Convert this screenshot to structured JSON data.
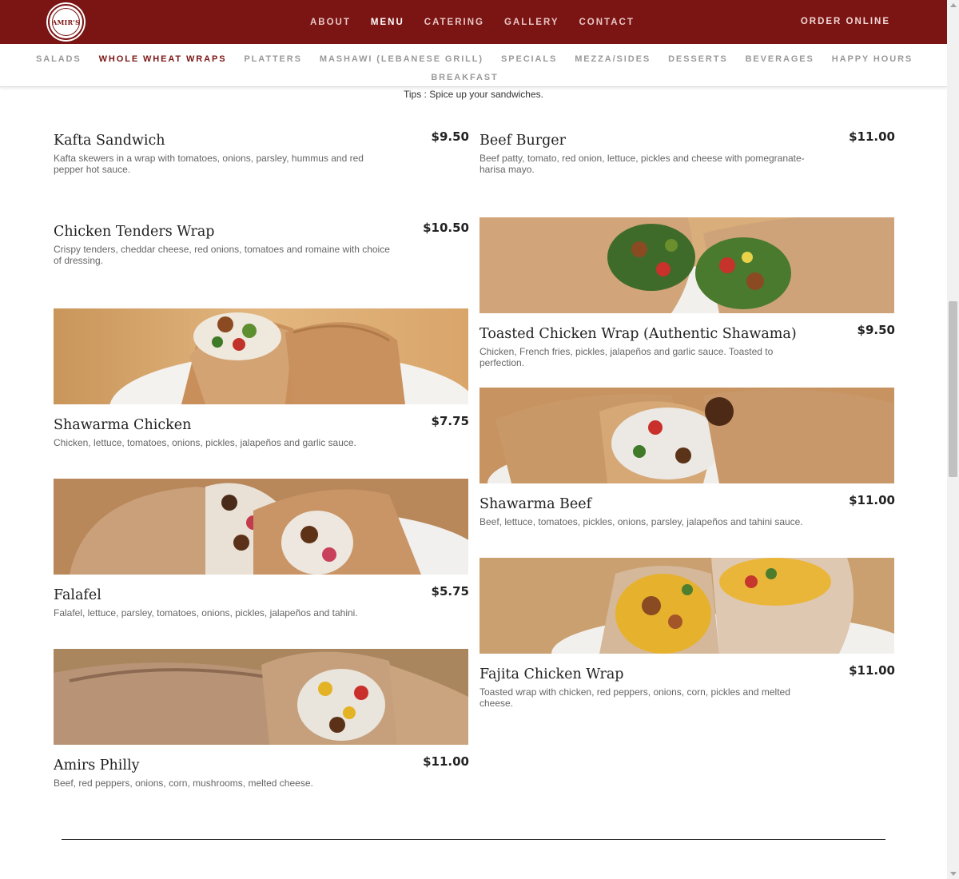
{
  "brand": {
    "logo_text": "AMIR'S",
    "color": "#7b1514"
  },
  "main_nav": {
    "items": [
      "ABOUT",
      "MENU",
      "CATERING",
      "GALLERY",
      "CONTACT"
    ],
    "active": "MENU",
    "order_online": "ORDER ONLINE"
  },
  "sub_nav": {
    "items": [
      "SALADS",
      "WHOLE WHEAT WRAPS",
      "PLATTERS",
      "MASHAWI (LEBANESE GRILL)",
      "SPECIALS",
      "MEZZA/SIDES",
      "DESSERTS",
      "BEVERAGES",
      "HAPPY HOURS"
    ],
    "second_row": "BREAKFAST",
    "active": "WHOLE WHEAT WRAPS"
  },
  "tips": "Tips : Spice up your sandwiches.",
  "menu": {
    "left": [
      {
        "name": "Kafta Sandwich",
        "price": "$9.50",
        "desc": "Kafta skewers in a wrap with tomatoes, onions, parsley, hummus and red pepper hot sauce.",
        "photo": ""
      },
      {
        "name": "Chicken Tenders Wrap",
        "price": "$10.50",
        "desc": "Crispy tenders, cheddar cheese, red onions, tomatoes and romaine with choice of dressing.",
        "photo": ""
      },
      {
        "name": "Shawarma Chicken",
        "price": "$7.75",
        "desc": "Chicken, lettuce, tomatoes, onions, pickles, jalapeños and garlic sauce.",
        "photo": "wrap-chicken"
      },
      {
        "name": "Falafel",
        "price": "$5.75",
        "desc": "Falafel, lettuce, parsley, tomatoes, onions, pickles, jalapeños and tahini.",
        "photo": "wrap-falafel"
      },
      {
        "name": "Amirs Philly",
        "price": "$11.00",
        "desc": "Beef, red peppers, onions, corn, mushrooms, melted cheese.",
        "photo": "wrap-philly"
      }
    ],
    "right": [
      {
        "name": "Beef Burger",
        "price": "$11.00",
        "desc": "Beef patty, tomato, red onion, lettuce, pickles and cheese with pomegranate-harisa mayo.",
        "photo": ""
      },
      {
        "name": "Toasted Chicken Wrap (Authentic Shawama)",
        "price": "$9.50",
        "desc": "Chicken, French fries, pickles, jalapeños and garlic sauce. Toasted to perfection.",
        "photo": "wrap-toasted"
      },
      {
        "name": "Shawarma Beef",
        "price": "$11.00",
        "desc": "Beef, lettuce, tomatoes, pickles, onions, parsley, jalapeños and tahini sauce.",
        "photo": "wrap-beef"
      },
      {
        "name": "Fajita Chicken Wrap",
        "price": "$11.00",
        "desc": "Toasted wrap with chicken, red peppers, onions, corn, pickles and melted cheese.",
        "photo": "wrap-fajita"
      }
    ]
  }
}
